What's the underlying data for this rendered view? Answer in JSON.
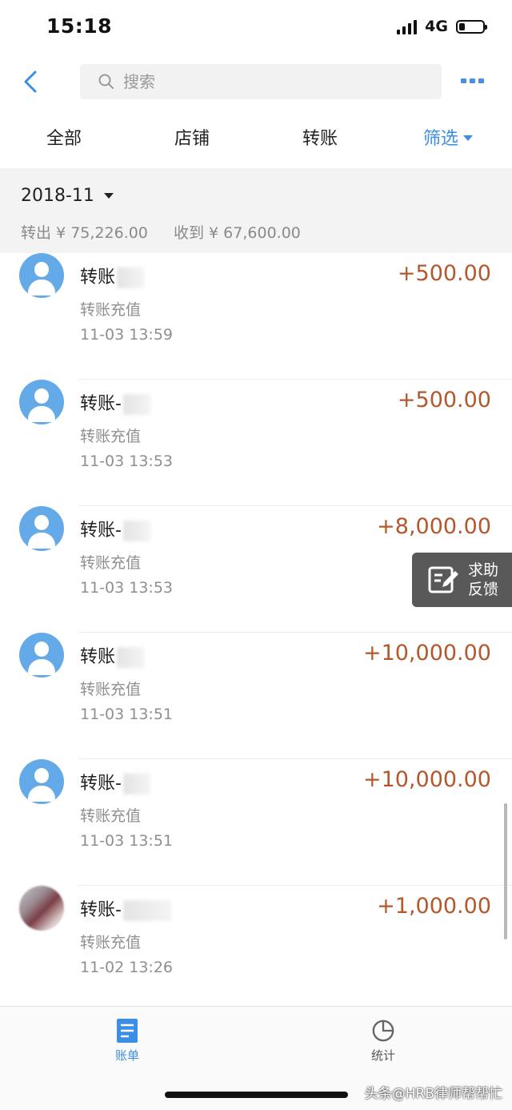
{
  "status_bar": {
    "time": "15:18",
    "network": "4G",
    "battery_level": 0.25
  },
  "nav": {
    "back_icon": "chevron-left-icon",
    "search_placeholder": "搜索",
    "more_icon": "more-dots-icon",
    "accent_color": "#3a8ee6"
  },
  "filter_tabs": [
    {
      "label": "全部"
    },
    {
      "label": "店铺"
    },
    {
      "label": "转账"
    },
    {
      "label": "筛选",
      "active": true
    }
  ],
  "month": {
    "label": "2018-11",
    "out_label": "转出",
    "out_amount": "¥ 75,226.00",
    "in_label": "收到",
    "in_amount": "¥ 67,600.00"
  },
  "transactions": [
    {
      "title": "转账",
      "subtitle": "转账充值",
      "time": "11-03  13:59",
      "amount": "+500.00",
      "avatar": "default-user-icon"
    },
    {
      "title": "转账-",
      "subtitle": "转账充值",
      "time": "11-03  13:53",
      "amount": "+500.00",
      "avatar": "default-user-icon"
    },
    {
      "title": "转账-",
      "subtitle": "转账充值",
      "time": "11-03  13:53",
      "amount": "+8,000.00",
      "avatar": "default-user-icon"
    },
    {
      "title": "转账",
      "subtitle": "转账充值",
      "time": "11-03  13:51",
      "amount": "+10,000.00",
      "avatar": "default-user-icon"
    },
    {
      "title": "转账-",
      "subtitle": "转账充值",
      "time": "11-03  13:51",
      "amount": "+10,000.00",
      "avatar": "default-user-icon"
    },
    {
      "title": "转账-",
      "subtitle": "转账充值",
      "time": "11-02  13:26",
      "amount": "+1,000.00",
      "avatar": "photo"
    }
  ],
  "amount_color": "#b5572c",
  "help_float": {
    "line1": "求助",
    "line2": "反馈"
  },
  "tab_bar": {
    "bill_label": "账单",
    "stats_label": "统计"
  },
  "watermark": "头条@HRB律师帮帮忙"
}
